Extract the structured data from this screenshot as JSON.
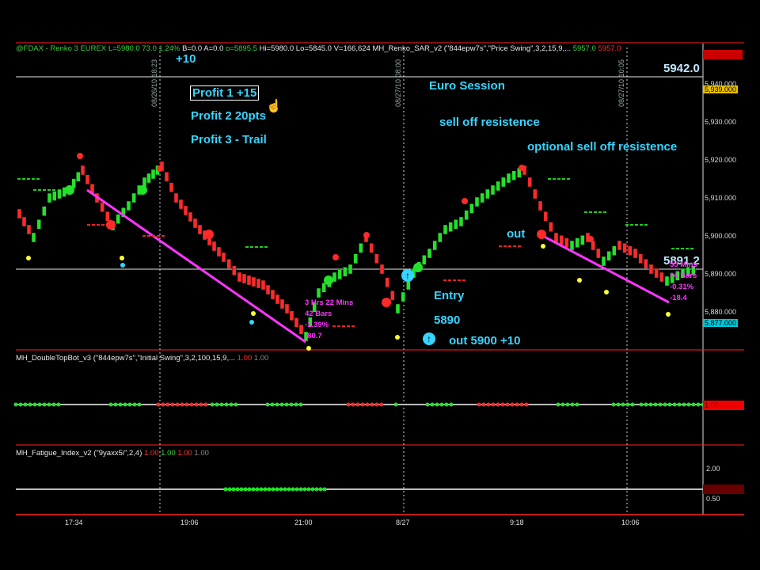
{
  "header": {
    "symbol": "@FDAX - Renko 3  EUREX",
    "last": "L=5980.0",
    "change": "73.0",
    "change_pct": "1.24%",
    "bid": "B=0.0",
    "ask": "A=0.0",
    "open": "o=5895.5",
    "high": "Hi=5980.0",
    "low": "Lo=5845.0",
    "volume": "V=166,624",
    "indicator": "MH_Renko_SAR_v2 (\"844epw7s\",\"Price Swing\",3,2,15,9,...",
    "ind_val1": "5957.0",
    "ind_val2": "5957.0"
  },
  "vlines": [
    {
      "label": "08/26/10 18:23"
    },
    {
      "label": "08/27/10 08:00"
    },
    {
      "label": "08/27/10 10:05"
    }
  ],
  "annotations": {
    "plus10": "+10",
    "profit1": "Profit 1 +15",
    "profit2": "Profit 2 20pts",
    "profit3": "Profit 3 - Trail",
    "euro": "Euro Session",
    "selloff": "sell off resistence",
    "optional": "optional sell off resistence",
    "out": "out",
    "entry": "Entry",
    "entry_price": "5890",
    "out_price": "out 5900 +10",
    "level_5942": "5942.0",
    "level_5891": "5891.2"
  },
  "swing_notes": {
    "left_time": "3 Hrs 22 Mins",
    "left_bars": "42 Bars",
    "left_pct": "-1.39%",
    "left_pts": "-80.7",
    "right_time": "55 Mins",
    "right_bars": "24 Bars",
    "right_pct": "-0.31%",
    "right_pts": "-18.4"
  },
  "price_axis": [
    "5,940.000",
    "5,930.000",
    "5,920.000",
    "5,910.000",
    "5,900.000",
    "5,890.000",
    "5,880.000"
  ],
  "price_tags": {
    "top": "5,939.000",
    "bottom": "5,877.000"
  },
  "panel2": {
    "title": "MH_DoubleTopBot_v3 (\"844epw7s\",\"Initial Swing\",3,2,100,15,9,...",
    "v1": "1.00",
    "v2": "1.00",
    "tag": "1.00"
  },
  "panel3": {
    "title": "MH_Fatigue_Index_v2 (\"9yaxx5i\",2,4)",
    "v1": "1.00",
    "v2": "1.00",
    "v3": "1.00",
    "v4": "1.00",
    "axis_top": "2.00",
    "axis_bot": "0.50"
  },
  "time_axis": [
    "17:34",
    "19:06",
    "21:00",
    "8/27",
    "9:18",
    "10:06"
  ],
  "colors": {
    "up": "#22e22a",
    "down": "#ff2a2a",
    "cyan": "#35d5ff",
    "magenta": "#ff34ff",
    "grid": "#d0d0d0"
  }
}
